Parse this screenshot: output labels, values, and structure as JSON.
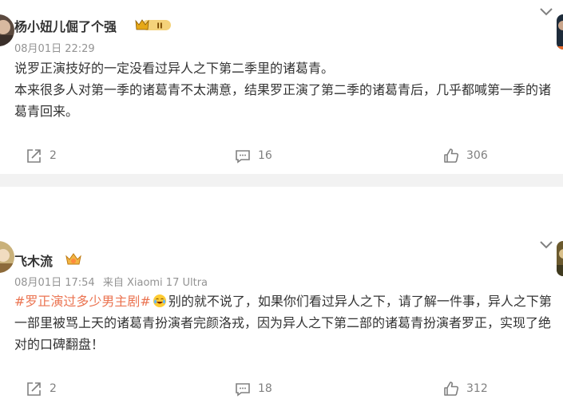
{
  "posts": [
    {
      "username": "杨小妞儿倔了个强",
      "badge_text": "II",
      "timestamp": "08月01日 22:29",
      "source": "",
      "topic": "",
      "lines": [
        "说罗正演技好的一定没看过异人之下第二季里的诸葛青。",
        "本来很多人对第一季的诸葛青不太满意，结果罗正演了第二季的诸葛青后，几乎都喊第一季的诸葛青回来。"
      ],
      "repost_count": "2",
      "comment_count": "16",
      "like_count": "306"
    },
    {
      "username": "飞木流",
      "badge_text": "",
      "timestamp": "08月01日 17:54",
      "source": "来自 Xiaomi 17 Ultra",
      "topic": "#罗正演过多少男主剧#",
      "lines": [
        "别的就不说了，如果你们看过异人之下，请了解一件事，异人之下第一部里被骂上天的诸葛青扮演者完颜洛戎，因为异人之下第二部的诸葛青扮演者罗正，实现了绝对的口碑翻盘！"
      ],
      "repost_count": "2",
      "comment_count": "18",
      "like_count": "312"
    }
  ],
  "colors": {
    "topic": "#eb7350",
    "meta": "#939393",
    "separator": "#f2f2f2",
    "badge_gold": "#e6b422"
  },
  "icons": [
    "repost-icon",
    "comment-icon",
    "like-icon",
    "chevron-down-icon",
    "laugh-cry-emoji"
  ]
}
